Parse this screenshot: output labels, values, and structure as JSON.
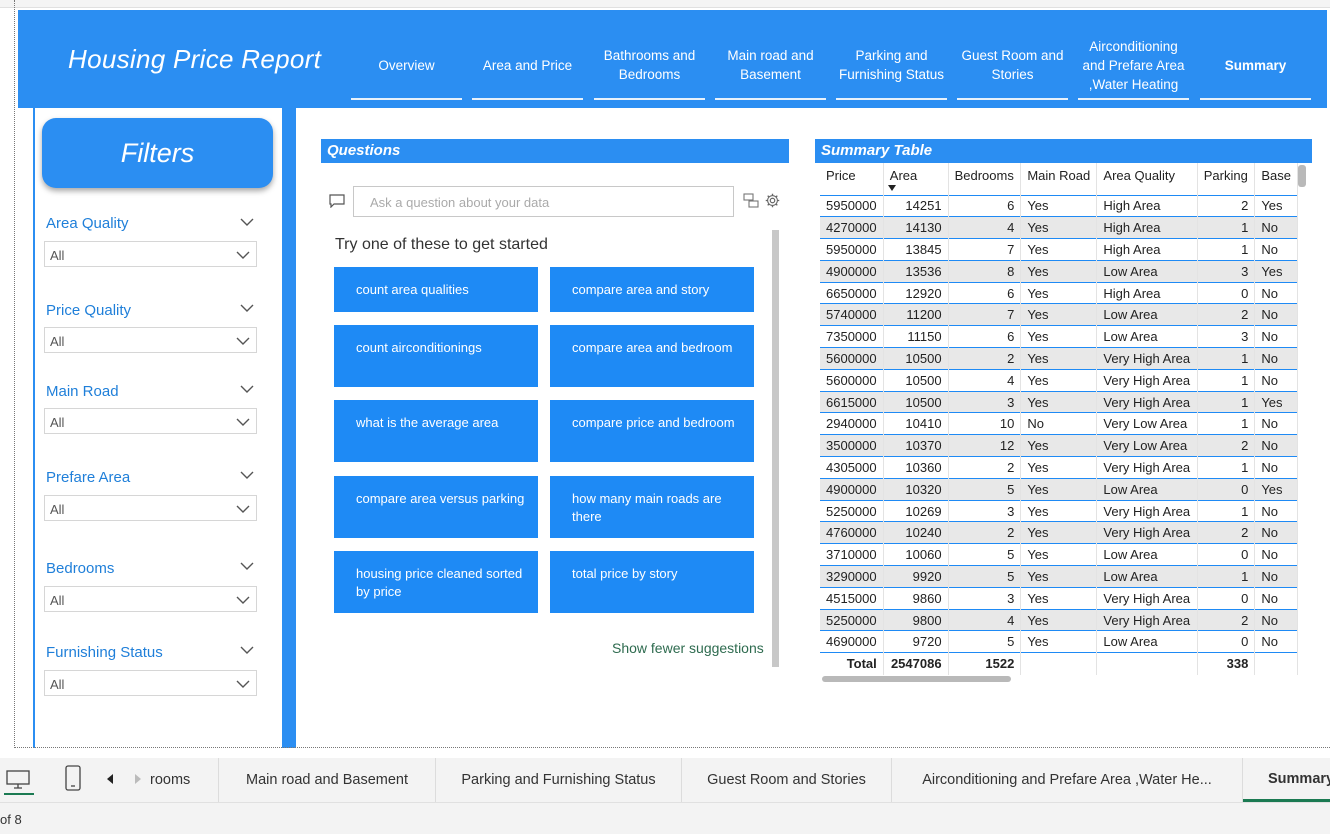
{
  "header": {
    "title": "Housing Price Report",
    "tabs": [
      {
        "label": "Overview"
      },
      {
        "label": "Area and Price"
      },
      {
        "label": "Bathrooms and Bedrooms"
      },
      {
        "label": "Main road and Basement"
      },
      {
        "label": "Parking and Furnishing Status"
      },
      {
        "label": "Guest Room and Stories"
      },
      {
        "label": "Airconditioning and Prefare Area ,Water Heating"
      },
      {
        "label": "Summary"
      }
    ]
  },
  "filters": {
    "title": "Filters",
    "items": [
      {
        "label": "Area Quality",
        "value": "All"
      },
      {
        "label": "Price Quality",
        "value": "All"
      },
      {
        "label": "Main Road",
        "value": "All"
      },
      {
        "label": "Prefare Area",
        "value": "All"
      },
      {
        "label": "Bedrooms",
        "value": "All"
      },
      {
        "label": "Furnishing Status",
        "value": "All"
      }
    ]
  },
  "questions": {
    "header": "Questions",
    "placeholder": "Ask a question about your data",
    "intro": "Try one of these to get started",
    "suggestions": [
      "count area qualities",
      "compare area and story",
      "count airconditionings",
      "compare area and bedroom",
      "what is the average area",
      "compare price and bedroom",
      "compare area versus parking",
      "how many main roads are there",
      "housing price cleaned sorted by price",
      "total price by story"
    ],
    "show_fewer": "Show fewer suggestions"
  },
  "summary_table": {
    "header": "Summary Table",
    "columns": [
      "Price",
      "Area",
      "Bedrooms",
      "Main Road",
      "Area Quality",
      "Parking",
      "Base"
    ],
    "rows": [
      [
        "5950000",
        "14251",
        "6",
        "Yes",
        "High Area",
        "2",
        "Yes"
      ],
      [
        "4270000",
        "14130",
        "4",
        "Yes",
        "High Area",
        "1",
        "No"
      ],
      [
        "5950000",
        "13845",
        "7",
        "Yes",
        "High Area",
        "1",
        "No"
      ],
      [
        "4900000",
        "13536",
        "8",
        "Yes",
        "Low Area",
        "3",
        "Yes"
      ],
      [
        "6650000",
        "12920",
        "6",
        "Yes",
        "High Area",
        "0",
        "No"
      ],
      [
        "5740000",
        "11200",
        "7",
        "Yes",
        "Low Area",
        "2",
        "No"
      ],
      [
        "7350000",
        "11150",
        "6",
        "Yes",
        "Low Area",
        "3",
        "No"
      ],
      [
        "5600000",
        "10500",
        "2",
        "Yes",
        "Very High Area",
        "1",
        "No"
      ],
      [
        "5600000",
        "10500",
        "4",
        "Yes",
        "Very High Area",
        "1",
        "No"
      ],
      [
        "6615000",
        "10500",
        "3",
        "Yes",
        "Very High Area",
        "1",
        "Yes"
      ],
      [
        "2940000",
        "10410",
        "10",
        "No",
        "Very Low Area",
        "1",
        "No"
      ],
      [
        "3500000",
        "10370",
        "12",
        "Yes",
        "Very Low Area",
        "2",
        "No"
      ],
      [
        "4305000",
        "10360",
        "2",
        "Yes",
        "Very High Area",
        "1",
        "No"
      ],
      [
        "4900000",
        "10320",
        "5",
        "Yes",
        "Low Area",
        "0",
        "Yes"
      ],
      [
        "5250000",
        "10269",
        "3",
        "Yes",
        "Very High Area",
        "1",
        "No"
      ],
      [
        "4760000",
        "10240",
        "2",
        "Yes",
        "Very High Area",
        "2",
        "No"
      ],
      [
        "3710000",
        "10060",
        "5",
        "Yes",
        "Low Area",
        "0",
        "No"
      ],
      [
        "3290000",
        "9920",
        "5",
        "Yes",
        "Low Area",
        "1",
        "No"
      ],
      [
        "4515000",
        "9860",
        "3",
        "Yes",
        "Very High Area",
        "0",
        "No"
      ],
      [
        "5250000",
        "9800",
        "4",
        "Yes",
        "Very High Area",
        "2",
        "No"
      ],
      [
        "4690000",
        "9720",
        "5",
        "Yes",
        "Low Area",
        "0",
        "No"
      ]
    ],
    "total": {
      "label": "Total",
      "area": "2547086",
      "bedrooms": "1522",
      "parking": "338"
    }
  },
  "page_tabs": [
    {
      "label": "rooms"
    },
    {
      "label": "Main road and Basement"
    },
    {
      "label": "Parking and Furnishing Status"
    },
    {
      "label": "Guest Room and Stories"
    },
    {
      "label": "Airconditioning and Prefare Area ,Water He..."
    },
    {
      "label": "Summary"
    }
  ],
  "status": {
    "page_info": "of 8"
  },
  "colors": {
    "accent": "#2b8ef2",
    "button": "#1e8af5",
    "filter_label": "#1f7fd9",
    "active_tab_underline": "#1b7a52"
  }
}
